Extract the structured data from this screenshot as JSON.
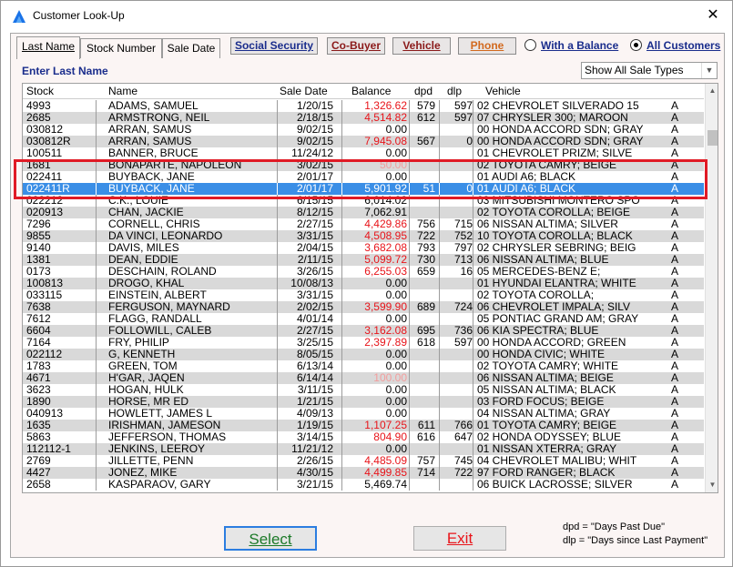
{
  "window": {
    "title": "Customer Look-Up",
    "close": "✕"
  },
  "tabs": [
    {
      "label": "Last Name"
    },
    {
      "label": "Stock Number"
    },
    {
      "label": "Sale Date"
    }
  ],
  "toolbar": {
    "social_security": "Social Security",
    "co_buyer": "Co-Buyer",
    "vehicle": "Vehicle",
    "phone": "Phone",
    "with_balance": "With a Balance",
    "all_customers": "All Customers",
    "selected_filter": "All Customers"
  },
  "colors": {
    "accent_blue": "#1a2d8c",
    "maroon": "#8b1a1a",
    "orange": "#d2691e",
    "negative": "#e8141a",
    "selected_row": "#3a8ee6",
    "highlight_box": "#e01a25"
  },
  "search": {
    "label": "Enter Last Name",
    "sale_type": "Show All Sale Types"
  },
  "columns": [
    "Stock",
    "Name",
    "Sale Date",
    "Balance",
    "dpd",
    "dlp",
    "Vehicle",
    ""
  ],
  "rows": [
    {
      "stock": "4993",
      "name": "ADAMS, SAMUEL",
      "date": "1/20/15",
      "balance": "1,326.62",
      "dpd": "579",
      "dlp": "597",
      "vehicle": "02 CHEVROLET SILVERADO 15",
      "type": "A",
      "neg": true
    },
    {
      "stock": "2685",
      "name": "ARMSTRONG, NEIL",
      "date": "2/18/15",
      "balance": "4,514.82",
      "dpd": "612",
      "dlp": "597",
      "vehicle": "07 CHRYSLER 300; MAROON",
      "type": "A",
      "neg": true
    },
    {
      "stock": "030812",
      "name": "ARRAN, SAMUS",
      "date": "9/02/15",
      "balance": "0.00",
      "dpd": "",
      "dlp": "",
      "vehicle": "00 HONDA ACCORD SDN; GRAY",
      "type": "A"
    },
    {
      "stock": "030812R",
      "name": "ARRAN, SAMUS",
      "date": "9/02/15",
      "balance": "7,945.08",
      "dpd": "567",
      "dlp": "0",
      "vehicle": "00 HONDA ACCORD SDN; GRAY",
      "type": "A",
      "neg": true
    },
    {
      "stock": "100511",
      "name": "BANNER, BRUCE",
      "date": "11/24/12",
      "balance": "0.00",
      "dpd": "",
      "dlp": "",
      "vehicle": "01 CHEVROLET PRIZM; SILVE",
      "type": "A"
    },
    {
      "stock": "1681",
      "name": "BONAPARTE, NAPOLEON",
      "date": "3/02/15",
      "balance": "50.00",
      "dpd": "",
      "dlp": "",
      "vehicle": "02 TOYOTA CAMRY; BEIGE",
      "type": "A",
      "pink": true
    },
    {
      "stock": "022411",
      "name": "BUYBACK, JANE",
      "date": "2/01/17",
      "balance": "0.00",
      "dpd": "",
      "dlp": "",
      "vehicle": "01 AUDI A6; BLACK",
      "type": "A"
    },
    {
      "stock": "022411R",
      "name": "BUYBACK, JANE",
      "date": "2/01/17",
      "balance": "5,901.92",
      "dpd": "51",
      "dlp": "0",
      "vehicle": "01 AUDI A6; BLACK",
      "type": "A",
      "neg": true,
      "selected": true
    },
    {
      "stock": "022212",
      "name": "C.K., LOUIE",
      "date": "6/15/15",
      "balance": "6,014.02",
      "dpd": "",
      "dlp": "",
      "vehicle": "03 MITSUBISHI MONTERO SPO",
      "type": "A"
    },
    {
      "stock": "020913",
      "name": "CHAN, JACKIE",
      "date": "8/12/15",
      "balance": "7,062.91",
      "dpd": "",
      "dlp": "",
      "vehicle": "02 TOYOTA COROLLA; BEIGE",
      "type": "A"
    },
    {
      "stock": "7296",
      "name": "CORNELL, CHRIS",
      "date": "2/27/15",
      "balance": "4,429.86",
      "dpd": "756",
      "dlp": "715",
      "vehicle": "06 NISSAN ALTIMA; SILVER",
      "type": "A",
      "neg": true
    },
    {
      "stock": "9855",
      "name": "DA VINCI, LEONARDO",
      "date": "3/31/15",
      "balance": "4,508.95",
      "dpd": "722",
      "dlp": "752",
      "vehicle": "10 TOYOTA COROLLA; BLACK",
      "type": "A",
      "neg": true
    },
    {
      "stock": "9140",
      "name": "DAVIS, MILES",
      "date": "2/04/15",
      "balance": "3,682.08",
      "dpd": "793",
      "dlp": "797",
      "vehicle": "02 CHRYSLER SEBRING; BEIG",
      "type": "A",
      "neg": true
    },
    {
      "stock": "1381",
      "name": "DEAN, EDDIE",
      "date": "2/11/15",
      "balance": "5,099.72",
      "dpd": "730",
      "dlp": "713",
      "vehicle": "06 NISSAN ALTIMA; BLUE",
      "type": "A",
      "neg": true
    },
    {
      "stock": "0173",
      "name": "DESCHAIN, ROLAND",
      "date": "3/26/15",
      "balance": "6,255.03",
      "dpd": "659",
      "dlp": "16",
      "vehicle": "05 MERCEDES-BENZ E;",
      "type": "A",
      "neg": true
    },
    {
      "stock": "100813",
      "name": "DROGO, KHAL",
      "date": "10/08/13",
      "balance": "0.00",
      "dpd": "",
      "dlp": "",
      "vehicle": "01 HYUNDAI ELANTRA; WHITE",
      "type": "A"
    },
    {
      "stock": "033115",
      "name": "EINSTEIN, ALBERT",
      "date": "3/31/15",
      "balance": "0.00",
      "dpd": "",
      "dlp": "",
      "vehicle": "02 TOYOTA COROLLA;",
      "type": "A"
    },
    {
      "stock": "7638",
      "name": "FERGUSON, MAYNARD",
      "date": "2/02/15",
      "balance": "3,599.90",
      "dpd": "689",
      "dlp": "724",
      "vehicle": "06 CHEVROLET IMPALA; SILV",
      "type": "A",
      "neg": true
    },
    {
      "stock": "7612",
      "name": "FLAGG, RANDALL",
      "date": "4/01/14",
      "balance": "0.00",
      "dpd": "",
      "dlp": "",
      "vehicle": "05 PONTIAC GRAND AM; GRAY",
      "type": "A"
    },
    {
      "stock": "6604",
      "name": "FOLLOWILL, CALEB",
      "date": "2/27/15",
      "balance": "3,162.08",
      "dpd": "695",
      "dlp": "736",
      "vehicle": "06 KIA SPECTRA; BLUE",
      "type": "A",
      "neg": true
    },
    {
      "stock": "7164",
      "name": "FRY, PHILIP",
      "date": "3/25/15",
      "balance": "2,397.89",
      "dpd": "618",
      "dlp": "597",
      "vehicle": "00 HONDA ACCORD; GREEN",
      "type": "A",
      "neg": true
    },
    {
      "stock": "022112",
      "name": "G, KENNETH",
      "date": "8/05/15",
      "balance": "0.00",
      "dpd": "",
      "dlp": "",
      "vehicle": "00 HONDA CIVIC; WHITE",
      "type": "A"
    },
    {
      "stock": "1783",
      "name": "GREEN, TOM",
      "date": "6/13/14",
      "balance": "0.00",
      "dpd": "",
      "dlp": "",
      "vehicle": "02 TOYOTA CAMRY; WHITE",
      "type": "A"
    },
    {
      "stock": "4671",
      "name": "H'GAR, JAQEN",
      "date": "6/14/14",
      "balance": "100.00",
      "dpd": "",
      "dlp": "",
      "vehicle": "06 NISSAN ALTIMA; BEIGE",
      "type": "A",
      "pink": true
    },
    {
      "stock": "3623",
      "name": "HOGAN, HULK",
      "date": "3/11/15",
      "balance": "0.00",
      "dpd": "",
      "dlp": "",
      "vehicle": "05 NISSAN ALTIMA; BLACK",
      "type": "A"
    },
    {
      "stock": "1890",
      "name": "HORSE, MR ED",
      "date": "1/21/15",
      "balance": "0.00",
      "dpd": "",
      "dlp": "",
      "vehicle": "03 FORD FOCUS; BEIGE",
      "type": "A"
    },
    {
      "stock": "040913",
      "name": "HOWLETT, JAMES L",
      "date": "4/09/13",
      "balance": "0.00",
      "dpd": "",
      "dlp": "",
      "vehicle": "04 NISSAN ALTIMA; GRAY",
      "type": "A"
    },
    {
      "stock": "1635",
      "name": "IRISHMAN, JAMESON",
      "date": "1/19/15",
      "balance": "1,107.25",
      "dpd": "611",
      "dlp": "766",
      "vehicle": "01 TOYOTA CAMRY; BEIGE",
      "type": "A",
      "neg": true
    },
    {
      "stock": "5863",
      "name": "JEFFERSON, THOMAS",
      "date": "3/14/15",
      "balance": "804.90",
      "dpd": "616",
      "dlp": "647",
      "vehicle": "02 HONDA ODYSSEY; BLUE",
      "type": "A",
      "neg": true
    },
    {
      "stock": "112112-1",
      "name": "JENKINS, LEEROY",
      "date": "11/21/12",
      "balance": "0.00",
      "dpd": "",
      "dlp": "",
      "vehicle": "01 NISSAN XTERRA; GRAY",
      "type": "A"
    },
    {
      "stock": "2769",
      "name": "JILLETTE, PENN",
      "date": "2/26/15",
      "balance": "4,485.09",
      "dpd": "757",
      "dlp": "745",
      "vehicle": "04 CHEVROLET MALIBU; WHIT",
      "type": "A",
      "neg": true
    },
    {
      "stock": "4427",
      "name": "JONEZ, MIKE",
      "date": "4/30/15",
      "balance": "4,499.85",
      "dpd": "714",
      "dlp": "722",
      "vehicle": "97 FORD RANGER; BLACK",
      "type": "A",
      "neg": true
    },
    {
      "stock": "2658",
      "name": "KASPARAOV, GARY",
      "date": "3/21/15",
      "balance": "5,469.74",
      "dpd": "",
      "dlp": "",
      "vehicle": "06 BUICK LACROSSE; SILVER",
      "type": "A"
    }
  ],
  "buttons": {
    "select": "Select",
    "exit": "Exit"
  },
  "legend": {
    "dpd": "dpd = \"Days Past Due\"",
    "dlp": "dlp = \"Days since Last Payment\""
  }
}
